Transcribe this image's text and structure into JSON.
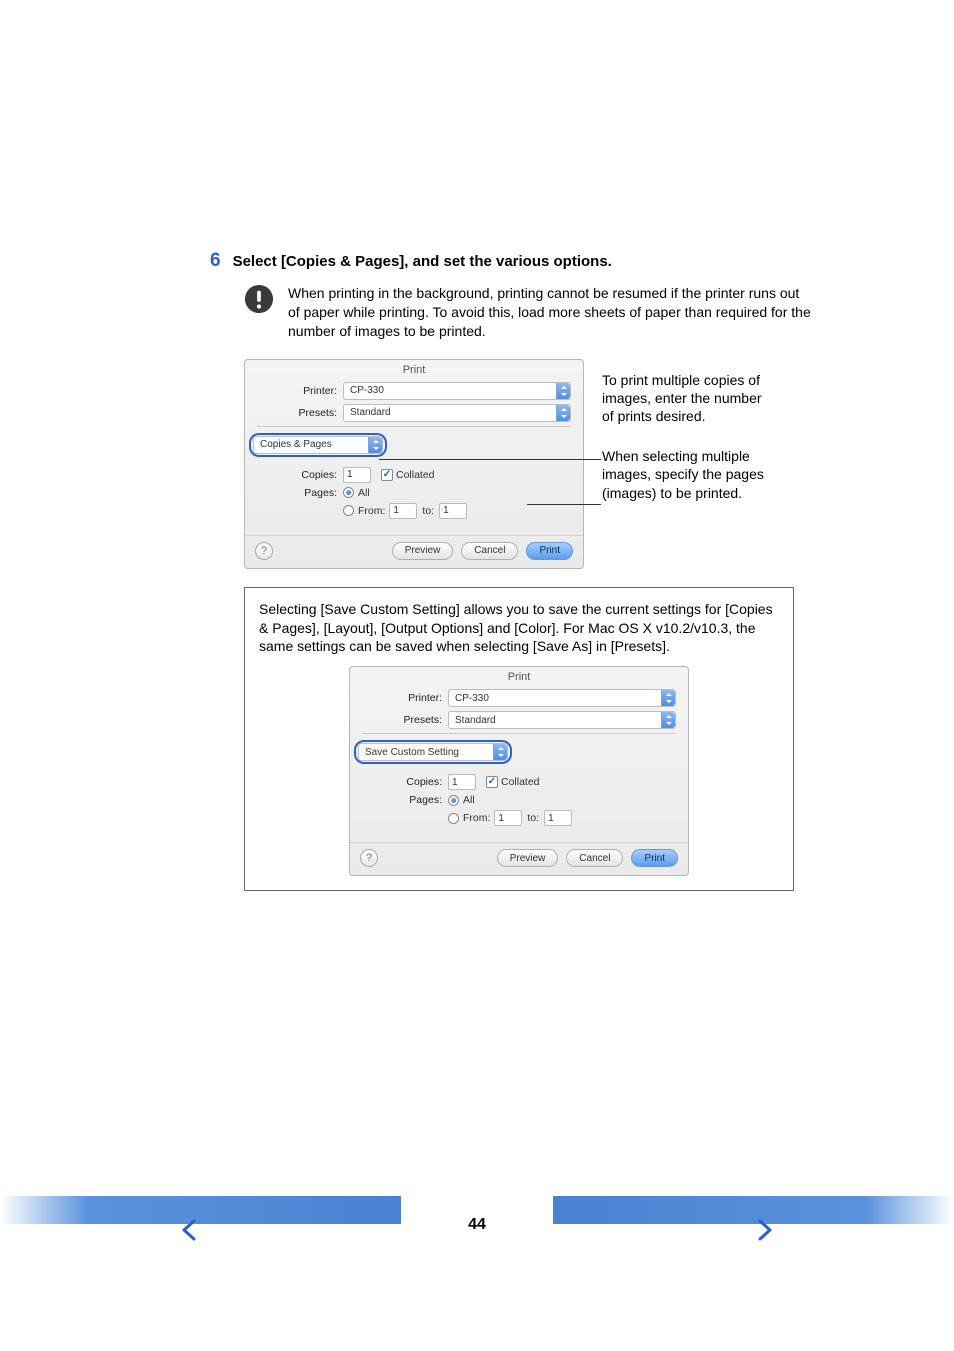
{
  "step": {
    "number": "6",
    "title": "Select [Copies & Pages], and set the various options."
  },
  "note": "When printing in the background, printing cannot be resumed if the printer runs out of paper while printing. To avoid this, load more sheets of paper than required for the number of images to be printed.",
  "dialog1": {
    "title": "Print",
    "printer_label": "Printer:",
    "printer_value": "CP-330",
    "presets_label": "Presets:",
    "presets_value": "Standard",
    "section_value": "Copies & Pages",
    "copies_label": "Copies:",
    "copies_value": "1",
    "collated_label": "Collated",
    "pages_label": "Pages:",
    "all_label": "All",
    "from_label": "From:",
    "from_value": "1",
    "to_label": "to:",
    "to_value": "1",
    "preview_btn": "Preview",
    "cancel_btn": "Cancel",
    "print_btn": "Print"
  },
  "callouts": {
    "c1": "To print multiple copies of images, enter the number of prints desired.",
    "c2": "When selecting multiple images, specify the pages (images) to be printed."
  },
  "info": "Selecting [Save Custom Setting] allows you to save the current settings for [Copies & Pages], [Layout], [Output Options] and [Color]. For Mac OS X v10.2/v10.3, the same settings can be saved when selecting [Save As] in [Presets].",
  "dialog2": {
    "title": "Print",
    "printer_label": "Printer:",
    "printer_value": "CP-330",
    "presets_label": "Presets:",
    "presets_value": "Standard",
    "section_value": "Save Custom Setting",
    "copies_label": "Copies:",
    "copies_value": "1",
    "collated_label": "Collated",
    "pages_label": "Pages:",
    "all_label": "All",
    "from_label": "From:",
    "from_value": "1",
    "to_label": "to:",
    "to_value": "1",
    "preview_btn": "Preview",
    "cancel_btn": "Cancel",
    "print_btn": "Print"
  },
  "page_number": "44"
}
